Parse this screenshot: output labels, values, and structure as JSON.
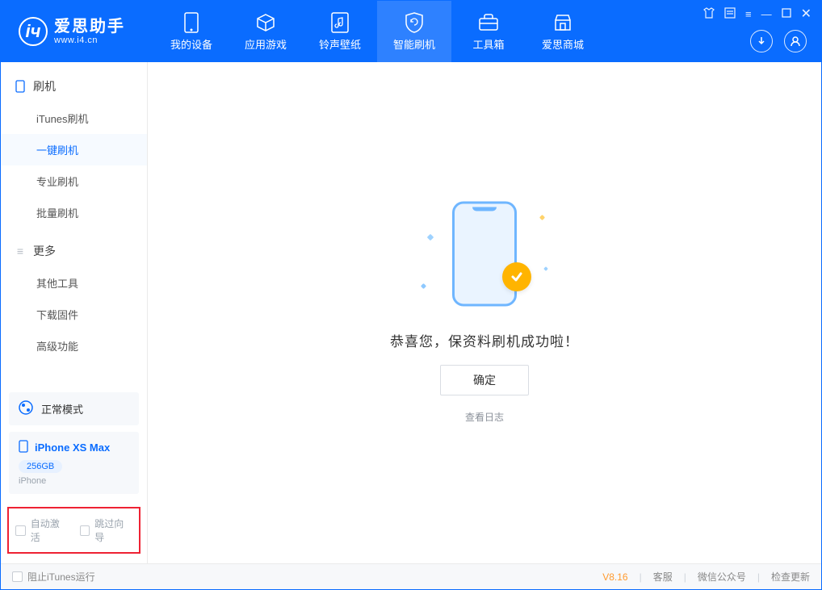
{
  "app": {
    "name": "爱思助手",
    "url": "www.i4.cn"
  },
  "header": {
    "tabs": [
      {
        "label": "我的设备",
        "icon": "device-icon"
      },
      {
        "label": "应用游戏",
        "icon": "cube-icon"
      },
      {
        "label": "铃声壁纸",
        "icon": "music-file-icon"
      },
      {
        "label": "智能刷机",
        "icon": "shield-refresh-icon",
        "active": true
      },
      {
        "label": "工具箱",
        "icon": "toolbox-icon"
      },
      {
        "label": "爱思商城",
        "icon": "shop-icon"
      }
    ]
  },
  "sidebar": {
    "group1_title": "刷机",
    "group1_items": [
      {
        "label": "iTunes刷机"
      },
      {
        "label": "一键刷机",
        "active": true
      },
      {
        "label": "专业刷机"
      },
      {
        "label": "批量刷机"
      }
    ],
    "group2_title": "更多",
    "group2_items": [
      {
        "label": "其他工具"
      },
      {
        "label": "下载固件"
      },
      {
        "label": "高级功能"
      }
    ],
    "status_label": "正常模式",
    "device": {
      "name": "iPhone XS Max",
      "storage": "256GB",
      "type": "iPhone"
    },
    "check_auto_activate": "自动激活",
    "check_skip_guide": "跳过向导"
  },
  "main": {
    "success_text": "恭喜您，保资料刷机成功啦！",
    "ok_button": "确定",
    "view_log": "查看日志"
  },
  "footer": {
    "block_itunes": "阻止iTunes运行",
    "version": "V8.16",
    "links": [
      "客服",
      "微信公众号",
      "检查更新"
    ]
  }
}
